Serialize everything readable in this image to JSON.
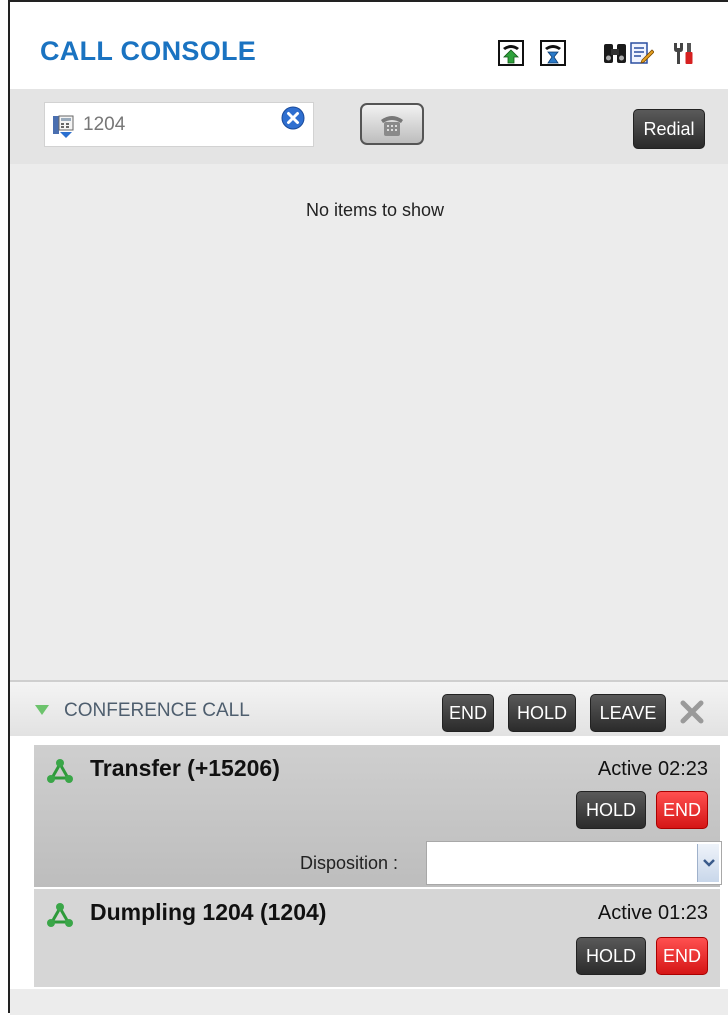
{
  "header": {
    "title": "CALL CONSOLE",
    "icons": [
      "call-forward-icon",
      "call-history-icon",
      "directory-search-icon",
      "notes-icon",
      "settings-tools-icon"
    ]
  },
  "dialer": {
    "number_value": "1204",
    "redial_label": "Redial"
  },
  "call_list": {
    "empty_message": "No items to show"
  },
  "conference": {
    "title": "CONFERENCE CALL",
    "end_label": "END",
    "hold_label": "HOLD",
    "leave_label": "LEAVE",
    "participants": [
      {
        "name": "Transfer (+15206)",
        "status": "Active 02:23",
        "hold_label": "HOLD",
        "end_label": "END",
        "disposition_label": "Disposition :",
        "disposition_value": ""
      },
      {
        "name": "Dumpling 1204 (1204)",
        "status": "Active 01:23",
        "hold_label": "HOLD",
        "end_label": "END"
      }
    ]
  },
  "colors": {
    "title_blue": "#1a73c1",
    "end_red": "#e02020",
    "conference_icon_green": "#2e9a3a"
  }
}
